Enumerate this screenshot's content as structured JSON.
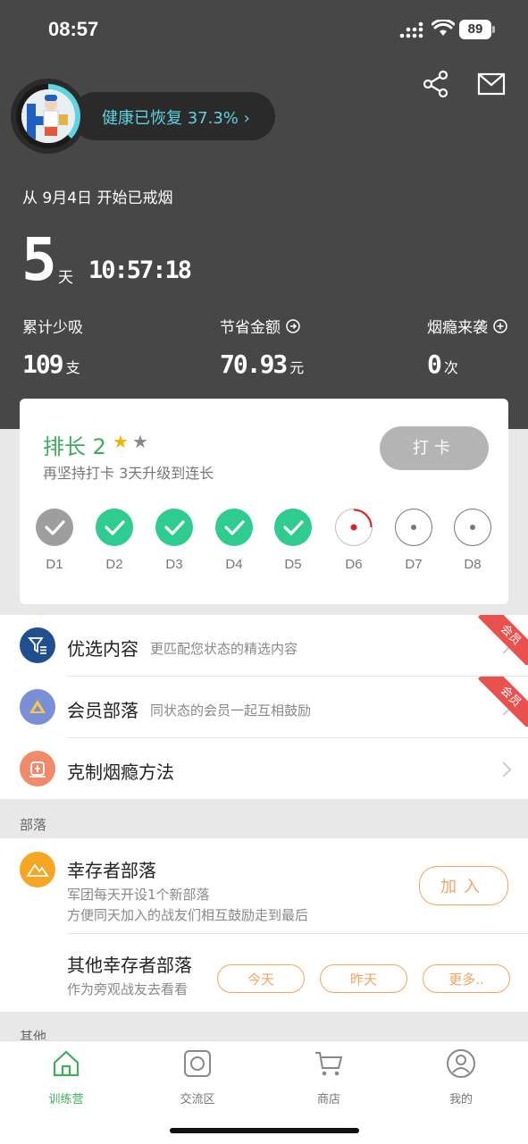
{
  "status": {
    "time": "08:57",
    "battery": "89"
  },
  "header": {
    "health_text": "健康已恢复 37.3% ›",
    "health_progress": 0.373,
    "since_text": "从 9月4日 开始已戒烟",
    "days": "5",
    "days_unit": "天",
    "clock": "10:57:18",
    "icons": [
      "share-icon",
      "mail-icon"
    ]
  },
  "stats": [
    {
      "label": "累计少吸",
      "value": "109",
      "unit": "支",
      "icon": ""
    },
    {
      "label": "节省金额",
      "value": "70.93",
      "unit": "元",
      "icon": "arrow-circle-icon"
    },
    {
      "label": "烟瘾来袭",
      "value": "0",
      "unit": "次",
      "icon": "plus-circle-icon"
    }
  ],
  "rank_card": {
    "title": "排长 2",
    "subtitle": "再坚持打卡 3天升级到连长",
    "checkin_label": "打卡",
    "stars": {
      "filled": 1,
      "total": 2
    },
    "days": [
      {
        "label": "D1",
        "state": "done-gray"
      },
      {
        "label": "D2",
        "state": "done"
      },
      {
        "label": "D3",
        "state": "done"
      },
      {
        "label": "D4",
        "state": "done"
      },
      {
        "label": "D5",
        "state": "done"
      },
      {
        "label": "D6",
        "state": "current"
      },
      {
        "label": "D7",
        "state": "pending"
      },
      {
        "label": "D8",
        "state": "pending"
      }
    ]
  },
  "list": [
    {
      "title": "优选内容",
      "desc": "更匹配您状态的精选内容",
      "badge": "会员",
      "icon": "filter-list-icon",
      "color": "#1f4f8f"
    },
    {
      "title": "会员部落",
      "desc": "同状态的会员一起互相鼓励",
      "badge": "会员",
      "icon": "triangle-icon",
      "color": "#7b8fd6"
    },
    {
      "title": "克制烟瘾方法",
      "desc": "",
      "badge": "",
      "icon": "lantern-icon",
      "color": "#f08a6a"
    }
  ],
  "sections": {
    "tribe": "部落",
    "other": "其他"
  },
  "tribe": {
    "title": "幸存者部落",
    "desc1": "军团每天开设1个新部落",
    "desc2": "方便同天加入的战友们相互鼓励走到最后",
    "join_label": "加入",
    "other_title": "其他幸存者部落",
    "other_desc": "作为旁观战友去看看",
    "filters": [
      "今天",
      "昨天",
      "更多.."
    ]
  },
  "tabs": [
    {
      "label": "训练营",
      "icon": "home-icon",
      "active": true
    },
    {
      "label": "交流区",
      "icon": "chat-icon",
      "active": false
    },
    {
      "label": "商店",
      "icon": "cart-icon",
      "active": false
    },
    {
      "label": "我的",
      "icon": "profile-icon",
      "active": false
    }
  ],
  "colors": {
    "accent_green": "#3fae5a",
    "health_cyan": "#5fd3e0",
    "orange": "#f4a460",
    "badge_red": "#e9514f",
    "header_bg": "#474747"
  }
}
